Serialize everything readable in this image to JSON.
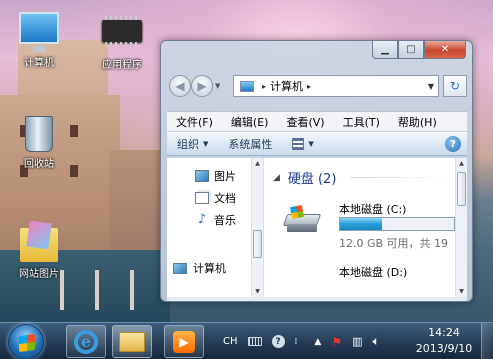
{
  "desktop": {
    "icons": [
      {
        "label": "计算机",
        "icon": "computer-icon"
      },
      {
        "label": "应用程序",
        "icon": "chip-icon"
      },
      {
        "label": "回收站",
        "icon": "recycle-bin-icon"
      },
      {
        "label": "网站图片",
        "icon": "folder-pictures-icon"
      }
    ]
  },
  "explorer": {
    "caption": {
      "minimize": "▁",
      "maximize": "□",
      "close": "✕"
    },
    "address": {
      "path": "计算机",
      "separator": "▸"
    },
    "menu": [
      "文件(F)",
      "编辑(E)",
      "查看(V)",
      "工具(T)",
      "帮助(H)"
    ],
    "toolbar": {
      "organize": "组织",
      "system_properties": "系统属性",
      "help": "?"
    },
    "nav": {
      "items": [
        "图片",
        "文档",
        "音乐"
      ],
      "computer": "计算机"
    },
    "group": {
      "title": "硬盘 (2)"
    },
    "drives": [
      {
        "name": "本地磁盘 (C:)",
        "free_text": "12.0 GB 可用，共 19",
        "used_fraction": 0.37
      },
      {
        "name": "本地磁盘 (D:)"
      }
    ]
  },
  "taskbar": {
    "tray": {
      "ime": "CH"
    },
    "clock": {
      "time": "14:24",
      "date": "2013/9/10"
    }
  },
  "colors": {
    "accent": "#26a0da",
    "taskbar": "#1c344e",
    "group_title": "#1e3b8a"
  }
}
